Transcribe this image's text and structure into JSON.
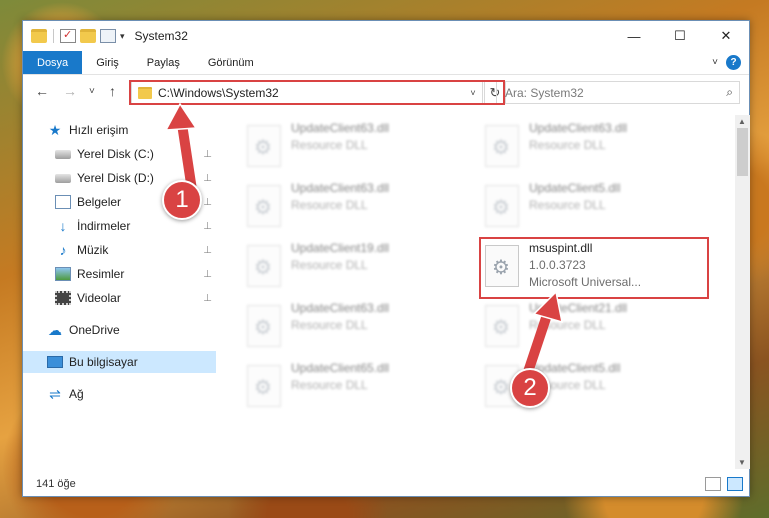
{
  "window": {
    "title": "System32",
    "controls": {
      "minimize": "—",
      "maximize": "☐",
      "close": "✕"
    }
  },
  "quick_access_toolbar": {
    "dropdown_glyph": "▾"
  },
  "ribbon": {
    "tabs": [
      "Dosya",
      "Giriş",
      "Paylaş",
      "Görünüm"
    ],
    "expand_glyph": "˅",
    "help_glyph": "?"
  },
  "nav": {
    "back_glyph": "←",
    "forward_glyph": "→",
    "recent_glyph": "˅",
    "up_glyph": "↑",
    "address_path": "C:\\Windows\\System32",
    "address_dropdown_glyph": "˅",
    "refresh_glyph": "↻",
    "search_placeholder": "Ara: System32",
    "search_glyph": "⌕"
  },
  "sidebar": {
    "items": [
      {
        "label": "Hızlı erişim",
        "icon": "star-icon",
        "pinned": false
      },
      {
        "label": "Yerel Disk (C:)",
        "icon": "disk-icon",
        "pinned": true
      },
      {
        "label": "Yerel Disk (D:)",
        "icon": "disk-icon",
        "pinned": true
      },
      {
        "label": "Belgeler",
        "icon": "documents-icon",
        "pinned": true
      },
      {
        "label": "İndirmeler",
        "icon": "downloads-icon",
        "pinned": true
      },
      {
        "label": "Müzik",
        "icon": "music-icon",
        "pinned": true
      },
      {
        "label": "Resimler",
        "icon": "pictures-icon",
        "pinned": true
      },
      {
        "label": "Videolar",
        "icon": "videos-icon",
        "pinned": true
      },
      {
        "label": "OneDrive",
        "icon": "cloud-icon",
        "pinned": false
      },
      {
        "label": "Bu bilgisayar",
        "icon": "computer-icon",
        "pinned": false,
        "selected": true
      },
      {
        "label": "Ağ",
        "icon": "network-icon",
        "pinned": false
      }
    ],
    "pin_glyph": "📌"
  },
  "files": [
    {
      "name": "UpdateClient63.dll",
      "desc": "Resource DLL",
      "blurred": true
    },
    {
      "name": "UpdateClient63.dll",
      "desc": "Resource DLL",
      "blurred": true
    },
    {
      "name": "UpdateClient63.dll",
      "desc": "Resource DLL",
      "blurred": true
    },
    {
      "name": "UpdateClient5.dll",
      "desc": "Resource DLL",
      "blurred": true
    },
    {
      "name": "UpdateClient19.dll",
      "desc": "Resource DLL",
      "blurred": true
    },
    {
      "name": "msuspint.dll",
      "desc": "1.0.0.3723",
      "desc2": "Microsoft Universal...",
      "blurred": false,
      "highlighted": true
    },
    {
      "name": "UpdateClient63.dll",
      "desc": "Resource DLL",
      "blurred": true
    },
    {
      "name": "UpdateClient21.dll",
      "desc": "Resource DLL",
      "blurred": true
    },
    {
      "name": "UpdateClient65.dll",
      "desc": "Resource DLL",
      "blurred": true
    },
    {
      "name": "UpdateClient5.dll",
      "desc": "Resource DLL",
      "blurred": true
    }
  ],
  "status": {
    "item_count": "141 öğe"
  },
  "callouts": {
    "first": "1",
    "second": "2"
  },
  "colors": {
    "accent": "#1979ca",
    "highlight": "#d94343",
    "selected_bg": "#cce8ff"
  }
}
